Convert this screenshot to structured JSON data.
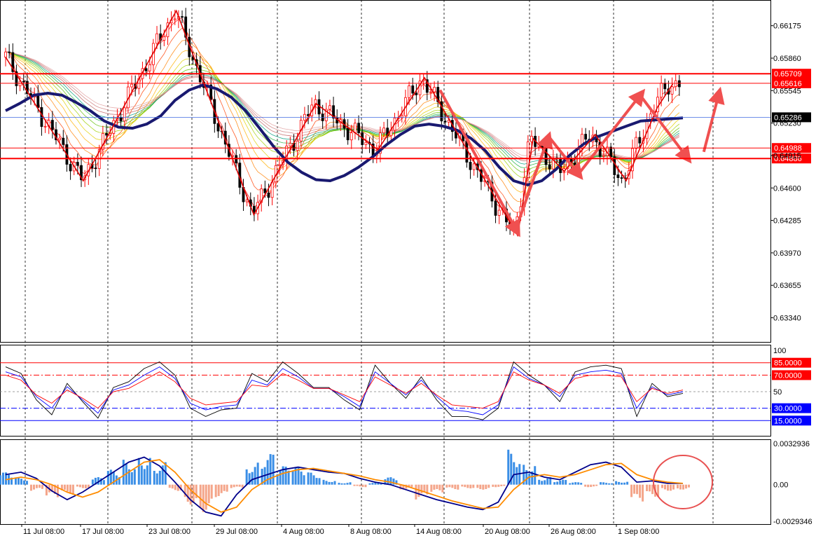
{
  "chart_data": [
    {
      "type": "candlestick",
      "name": "price-panel",
      "y_ticks": [
        "0.66175",
        "0.65860",
        "0.65545",
        "0.65230",
        "0.64915",
        "0.64600",
        "0.64285",
        "0.63970",
        "0.63655",
        "0.63340"
      ],
      "ylim": [
        0.6316,
        0.6637
      ],
      "levels": [
        {
          "label": "0.65709",
          "value": 0.65709,
          "color": "#ff0000",
          "style": "thick"
        },
        {
          "label": "0.65616",
          "value": 0.65616,
          "color": "#ff0000",
          "style": "thin"
        },
        {
          "label": "0.64988",
          "value": 0.64988,
          "color": "#ff0000",
          "style": "thin"
        },
        {
          "label": "0.64886",
          "value": 0.64886,
          "color": "#ff0000",
          "style": "thick"
        }
      ],
      "current_price": {
        "label": "0.65286",
        "value": 0.65286,
        "color": "#000000"
      },
      "x_labels": [
        "11 Jul 08:00",
        "17 Jul 08:00",
        "23 Jul 08:00",
        "29 Jul 08:00",
        "4 Aug 08:00",
        "8 Aug 08:00",
        "14 Aug 08:00",
        "20 Aug 08:00",
        "26 Aug 08:00",
        "1 Sep 08:00"
      ],
      "slow_ma": [
        0.6535,
        0.6542,
        0.655,
        0.6552,
        0.655,
        0.6543,
        0.6535,
        0.6525,
        0.6519,
        0.6518,
        0.6522,
        0.653,
        0.6545,
        0.6555,
        0.656,
        0.6556,
        0.6548,
        0.6535,
        0.6518,
        0.65,
        0.6485,
        0.6475,
        0.6468,
        0.6467,
        0.6472,
        0.648,
        0.649,
        0.6502,
        0.6512,
        0.652,
        0.6522,
        0.652,
        0.6516,
        0.6508,
        0.6496,
        0.648,
        0.6467,
        0.6463,
        0.6467,
        0.6478,
        0.6492,
        0.6503,
        0.651,
        0.6515,
        0.652,
        0.6525,
        0.6526,
        0.6527,
        0.6528
      ],
      "zigzag": [
        [
          0,
          0.6587
        ],
        [
          5,
          0.6467
        ],
        [
          11,
          0.6632
        ],
        [
          16,
          0.6434
        ],
        [
          20,
          0.6542
        ],
        [
          24,
          0.6497
        ],
        [
          27,
          0.6567
        ],
        [
          33,
          0.6414
        ],
        [
          34,
          0.6508
        ],
        [
          36,
          0.6476
        ],
        [
          38,
          0.6512
        ],
        [
          40,
          0.6467
        ],
        [
          42,
          0.6538
        ],
        [
          43,
          0.6561
        ]
      ],
      "arrows": [
        [
          28,
          0.6555,
          33,
          0.6417
        ],
        [
          33,
          0.6425,
          35,
          0.651
        ],
        [
          35,
          0.651,
          37,
          0.6472
        ],
        [
          37,
          0.6475,
          41,
          0.6552
        ],
        [
          41,
          0.6548,
          44,
          0.6488
        ],
        [
          45,
          0.6495,
          46,
          0.6553
        ]
      ]
    },
    {
      "type": "line",
      "name": "oscillator-panel",
      "y_ticks": [
        "100",
        "50"
      ],
      "ylim": [
        0,
        100
      ],
      "levels": [
        {
          "label": "85.0000",
          "value": 85,
          "color": "#ff0000",
          "style": "solid"
        },
        {
          "label": "70.0000",
          "value": 70,
          "color": "#ff0000",
          "style": "dashdot"
        },
        {
          "label": "30.0000",
          "value": 30,
          "color": "#0000ff",
          "style": "dashdot"
        },
        {
          "label": "15.0000",
          "value": 15,
          "color": "#0000ff",
          "style": "solid"
        }
      ],
      "series": [
        {
          "color": "#000000",
          "values": [
            80,
            72,
            40,
            22,
            60,
            38,
            18,
            55,
            62,
            78,
            86,
            70,
            30,
            20,
            28,
            30,
            72,
            62,
            86,
            72,
            55,
            55,
            40,
            28,
            82,
            60,
            42,
            68,
            40,
            20,
            20,
            16,
            30,
            86,
            70,
            58,
            38,
            74,
            80,
            82,
            78,
            20,
            60,
            44,
            48
          ]
        },
        {
          "color": "#0000ff",
          "values": [
            74,
            68,
            44,
            30,
            56,
            40,
            24,
            52,
            58,
            70,
            80,
            66,
            36,
            28,
            32,
            34,
            64,
            58,
            78,
            68,
            54,
            54,
            44,
            32,
            74,
            60,
            46,
            64,
            44,
            28,
            26,
            22,
            34,
            80,
            66,
            58,
            44,
            70,
            74,
            76,
            72,
            30,
            56,
            46,
            50
          ]
        },
        {
          "color": "#ff0000",
          "values": [
            70,
            64,
            46,
            36,
            52,
            42,
            30,
            50,
            54,
            64,
            74,
            62,
            42,
            34,
            36,
            38,
            58,
            56,
            72,
            64,
            54,
            54,
            46,
            38,
            68,
            58,
            48,
            60,
            46,
            34,
            32,
            30,
            38,
            74,
            64,
            58,
            48,
            66,
            70,
            70,
            68,
            38,
            54,
            48,
            52
          ]
        }
      ]
    },
    {
      "type": "bar",
      "name": "macd-panel",
      "y_ticks": [
        "0.0032936",
        "0.00",
        "-0.0029346"
      ],
      "ylim": [
        -0.0029346,
        0.0032936
      ],
      "histogram": [
        0.001,
        0.0006,
        -0.0005,
        -0.0011,
        -0.0008,
        -0.0003,
        0.0006,
        0.0012,
        0.002,
        0.0025,
        0.0018,
        -0.0005,
        -0.0016,
        -0.0022,
        -0.001,
        -0.0003,
        0.0018,
        0.0025,
        0.0015,
        0.0014,
        0.001,
        0.0004,
        0.0002,
        -0.0002,
        0.0002,
        0.0006,
        -0.0004,
        -0.0012,
        -0.0007,
        -0.0004,
        -0.0003,
        -0.0004,
        -0.0002,
        0.0028,
        0.0018,
        0.0006,
        0.0004,
        0.0002,
        -0.0002,
        0.0002,
        0.0003,
        -0.0014,
        -0.001,
        -0.0005,
        -0.0004
      ],
      "series": [
        {
          "color": "#00008b",
          "values": [
            0.0008,
            0.001,
            0.0005,
            -0.0005,
            -0.0012,
            -0.0006,
            0.0002,
            0.001,
            0.0018,
            0.0022,
            0.0015,
            0.0002,
            -0.0012,
            -0.0022,
            -0.0025,
            -0.0008,
            0.0004,
            0.0008,
            0.0012,
            0.0014,
            0.0012,
            0.001,
            0.0009,
            0.0005,
            0.0002,
            0.0,
            -0.0004,
            -0.0008,
            -0.0012,
            -0.0015,
            -0.0018,
            -0.002,
            -0.0014,
            0.0008,
            0.001,
            0.0006,
            0.0004,
            0.001,
            0.0016,
            0.0018,
            0.0014,
            0.0002,
            0.0003,
            0.0001,
            0.0001
          ]
        },
        {
          "color": "#ff8c00",
          "values": [
            0.0004,
            0.0006,
            0.0004,
            0.0,
            -0.0006,
            -0.001,
            -0.0006,
            0.0002,
            0.001,
            0.0018,
            0.002,
            0.001,
            -0.0004,
            -0.0015,
            -0.0022,
            -0.0018,
            -0.0004,
            0.0004,
            0.0009,
            0.0012,
            0.0013,
            0.0011,
            0.0009,
            0.0007,
            0.0004,
            0.0002,
            -0.0001,
            -0.0005,
            -0.0009,
            -0.0013,
            -0.0016,
            -0.0019,
            -0.0018,
            -0.0004,
            0.0006,
            0.0008,
            0.0006,
            0.0008,
            0.0012,
            0.0016,
            0.0017,
            0.0008,
            0.0004,
            0.0002,
            0.0001
          ]
        }
      ],
      "annotation": "circle"
    }
  ],
  "colors": {
    "bull": "#ff0000",
    "bear": "#000000",
    "slow_ma": "#191970",
    "zigzag": "#dd0000",
    "arrow": "#f05050",
    "grid": "#000000"
  }
}
